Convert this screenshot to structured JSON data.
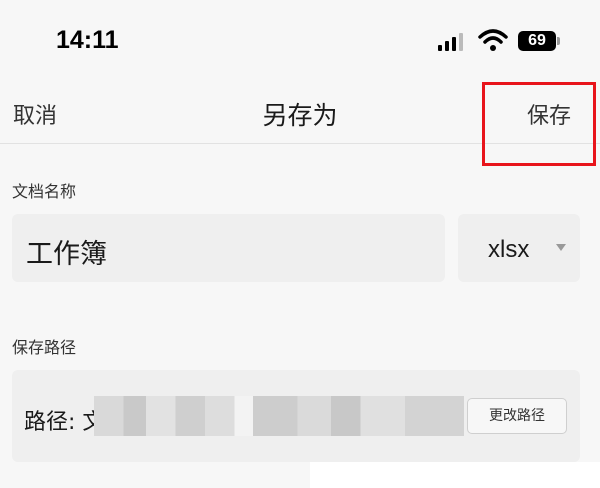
{
  "status_bar": {
    "time": "14:11",
    "battery": "69",
    "icons": [
      "signal-icon",
      "wifi-icon",
      "battery-icon"
    ]
  },
  "nav": {
    "cancel_label": "取消",
    "title": "另存为",
    "save_label": "保存"
  },
  "document": {
    "section_label": "文档名称",
    "name_value": "工作簿",
    "format_value": "xlsx"
  },
  "save_path": {
    "section_label": "保存路径",
    "path_label": "路径: 文",
    "change_button_label": "更改路径"
  },
  "colors": {
    "highlight": "#e8141b",
    "background": "#f7f7f7",
    "field_background": "#efefef"
  }
}
